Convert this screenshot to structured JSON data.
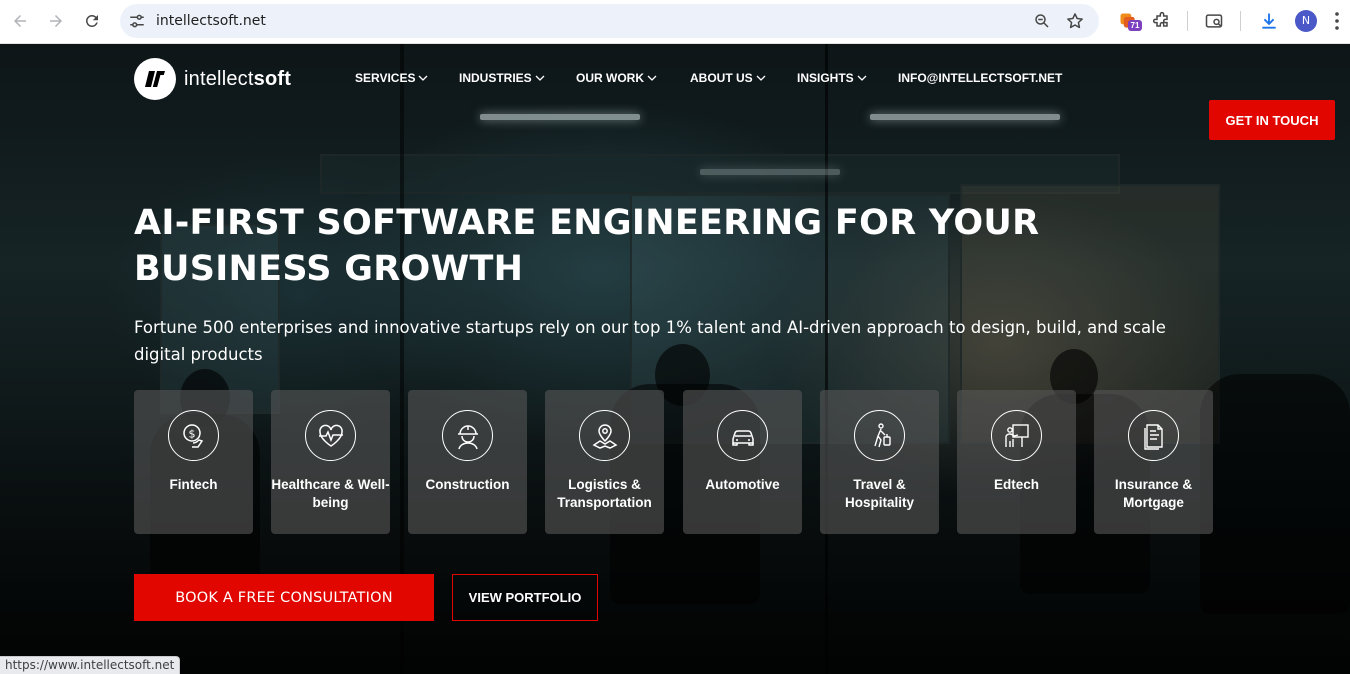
{
  "browser": {
    "url": "intellectsoft.net",
    "extension_badge": "71",
    "profile_initial": "N",
    "status_url": "https://www.intellectsoft.net"
  },
  "site": {
    "logo_text_light": "intellect",
    "logo_text_bold": "soft",
    "nav": [
      "SERVICES",
      "INDUSTRIES",
      "OUR WORK",
      "ABOUT US",
      "INSIGHTS"
    ],
    "email": "INFO@INTELLECTSOFT.NET",
    "cta_touch": "GET IN TOUCH"
  },
  "hero": {
    "headline": "AI-FIRST SOFTWARE ENGINEERING FOR YOUR BUSINESS GROWTH",
    "subline": "Fortune 500 enterprises and innovative startups rely on our top 1% talent and AI-driven approach to design, build, and scale digital products",
    "tiles": [
      {
        "label": "Fintech",
        "icon": "dollar-hand-icon"
      },
      {
        "label": "Healthcare & Well-being",
        "icon": "heart-pulse-icon"
      },
      {
        "label": "Construction",
        "icon": "hard-hat-worker-icon"
      },
      {
        "label": "Logistics & Transportation",
        "icon": "map-pin-icon"
      },
      {
        "label": "Automotive",
        "icon": "car-icon"
      },
      {
        "label": "Travel & Hospitality",
        "icon": "traveler-luggage-icon"
      },
      {
        "label": "Edtech",
        "icon": "teacher-board-icon"
      },
      {
        "label": "Insurance & Mortgage",
        "icon": "document-icon"
      }
    ],
    "btn_consult": "BOOK A FREE CONSULTATION",
    "btn_portfolio": "VIEW PORTFOLIO"
  },
  "colors": {
    "accent_red": "#e10600",
    "tile_bg": "#555555"
  }
}
